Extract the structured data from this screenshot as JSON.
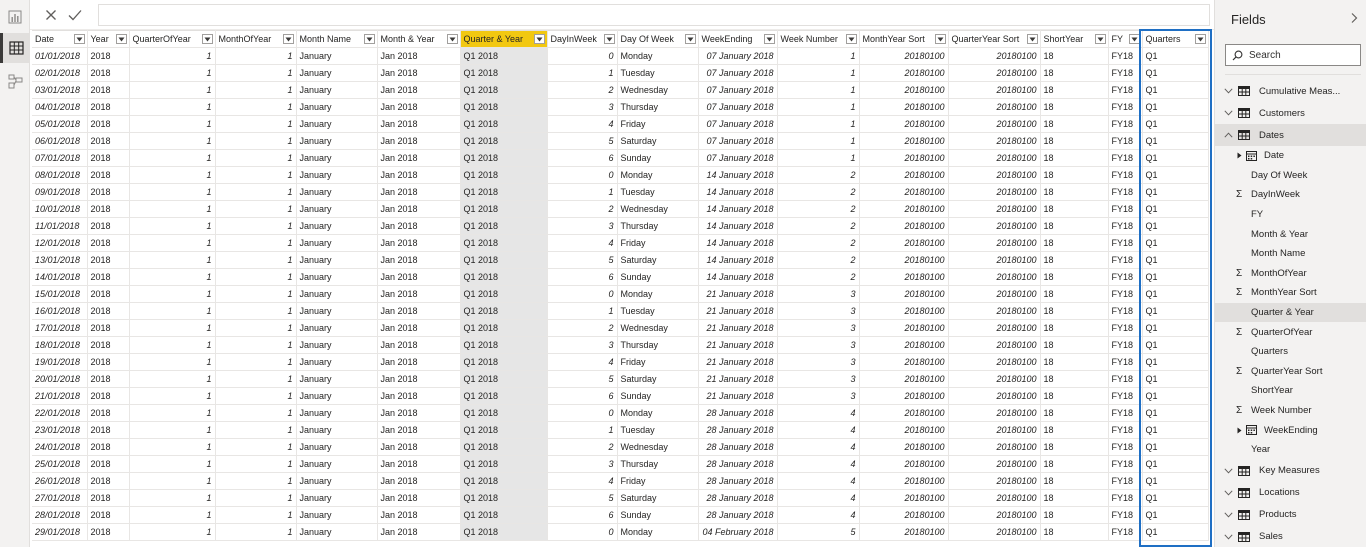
{
  "rail": {
    "icons": [
      "report-view-icon",
      "data-view-icon",
      "model-view-icon"
    ]
  },
  "formula_bar": {
    "value": ""
  },
  "grid": {
    "columns": [
      {
        "label": "Date",
        "type": "ital",
        "sort": "asc"
      },
      {
        "label": "Year",
        "type": "text"
      },
      {
        "label": "QuarterOfYear",
        "type": "num"
      },
      {
        "label": "MonthOfYear",
        "type": "num"
      },
      {
        "label": "Month Name",
        "type": "text"
      },
      {
        "label": "Month & Year",
        "type": "text"
      },
      {
        "label": "Quarter & Year",
        "type": "text",
        "selected": true
      },
      {
        "label": "DayInWeek",
        "type": "num"
      },
      {
        "label": "Day Of Week",
        "type": "text"
      },
      {
        "label": "WeekEnding",
        "type": "ital-num"
      },
      {
        "label": "Week Number",
        "type": "num"
      },
      {
        "label": "MonthYear Sort",
        "type": "num"
      },
      {
        "label": "QuarterYear Sort",
        "type": "num"
      },
      {
        "label": "ShortYear",
        "type": "text"
      },
      {
        "label": "FY",
        "type": "text"
      },
      {
        "label": "Quarters",
        "type": "text"
      }
    ],
    "rows": [
      [
        "01/01/2018",
        "2018",
        "1",
        "1",
        "January",
        "Jan 2018",
        "Q1 2018",
        "0",
        "Monday",
        "07 January 2018",
        "1",
        "20180100",
        "20180100",
        "18",
        "FY18",
        "Q1"
      ],
      [
        "02/01/2018",
        "2018",
        "1",
        "1",
        "January",
        "Jan 2018",
        "Q1 2018",
        "1",
        "Tuesday",
        "07 January 2018",
        "1",
        "20180100",
        "20180100",
        "18",
        "FY18",
        "Q1"
      ],
      [
        "03/01/2018",
        "2018",
        "1",
        "1",
        "January",
        "Jan 2018",
        "Q1 2018",
        "2",
        "Wednesday",
        "07 January 2018",
        "1",
        "20180100",
        "20180100",
        "18",
        "FY18",
        "Q1"
      ],
      [
        "04/01/2018",
        "2018",
        "1",
        "1",
        "January",
        "Jan 2018",
        "Q1 2018",
        "3",
        "Thursday",
        "07 January 2018",
        "1",
        "20180100",
        "20180100",
        "18",
        "FY18",
        "Q1"
      ],
      [
        "05/01/2018",
        "2018",
        "1",
        "1",
        "January",
        "Jan 2018",
        "Q1 2018",
        "4",
        "Friday",
        "07 January 2018",
        "1",
        "20180100",
        "20180100",
        "18",
        "FY18",
        "Q1"
      ],
      [
        "06/01/2018",
        "2018",
        "1",
        "1",
        "January",
        "Jan 2018",
        "Q1 2018",
        "5",
        "Saturday",
        "07 January 2018",
        "1",
        "20180100",
        "20180100",
        "18",
        "FY18",
        "Q1"
      ],
      [
        "07/01/2018",
        "2018",
        "1",
        "1",
        "January",
        "Jan 2018",
        "Q1 2018",
        "6",
        "Sunday",
        "07 January 2018",
        "1",
        "20180100",
        "20180100",
        "18",
        "FY18",
        "Q1"
      ],
      [
        "08/01/2018",
        "2018",
        "1",
        "1",
        "January",
        "Jan 2018",
        "Q1 2018",
        "0",
        "Monday",
        "14 January 2018",
        "2",
        "20180100",
        "20180100",
        "18",
        "FY18",
        "Q1"
      ],
      [
        "09/01/2018",
        "2018",
        "1",
        "1",
        "January",
        "Jan 2018",
        "Q1 2018",
        "1",
        "Tuesday",
        "14 January 2018",
        "2",
        "20180100",
        "20180100",
        "18",
        "FY18",
        "Q1"
      ],
      [
        "10/01/2018",
        "2018",
        "1",
        "1",
        "January",
        "Jan 2018",
        "Q1 2018",
        "2",
        "Wednesday",
        "14 January 2018",
        "2",
        "20180100",
        "20180100",
        "18",
        "FY18",
        "Q1"
      ],
      [
        "11/01/2018",
        "2018",
        "1",
        "1",
        "January",
        "Jan 2018",
        "Q1 2018",
        "3",
        "Thursday",
        "14 January 2018",
        "2",
        "20180100",
        "20180100",
        "18",
        "FY18",
        "Q1"
      ],
      [
        "12/01/2018",
        "2018",
        "1",
        "1",
        "January",
        "Jan 2018",
        "Q1 2018",
        "4",
        "Friday",
        "14 January 2018",
        "2",
        "20180100",
        "20180100",
        "18",
        "FY18",
        "Q1"
      ],
      [
        "13/01/2018",
        "2018",
        "1",
        "1",
        "January",
        "Jan 2018",
        "Q1 2018",
        "5",
        "Saturday",
        "14 January 2018",
        "2",
        "20180100",
        "20180100",
        "18",
        "FY18",
        "Q1"
      ],
      [
        "14/01/2018",
        "2018",
        "1",
        "1",
        "January",
        "Jan 2018",
        "Q1 2018",
        "6",
        "Sunday",
        "14 January 2018",
        "2",
        "20180100",
        "20180100",
        "18",
        "FY18",
        "Q1"
      ],
      [
        "15/01/2018",
        "2018",
        "1",
        "1",
        "January",
        "Jan 2018",
        "Q1 2018",
        "0",
        "Monday",
        "21 January 2018",
        "3",
        "20180100",
        "20180100",
        "18",
        "FY18",
        "Q1"
      ],
      [
        "16/01/2018",
        "2018",
        "1",
        "1",
        "January",
        "Jan 2018",
        "Q1 2018",
        "1",
        "Tuesday",
        "21 January 2018",
        "3",
        "20180100",
        "20180100",
        "18",
        "FY18",
        "Q1"
      ],
      [
        "17/01/2018",
        "2018",
        "1",
        "1",
        "January",
        "Jan 2018",
        "Q1 2018",
        "2",
        "Wednesday",
        "21 January 2018",
        "3",
        "20180100",
        "20180100",
        "18",
        "FY18",
        "Q1"
      ],
      [
        "18/01/2018",
        "2018",
        "1",
        "1",
        "January",
        "Jan 2018",
        "Q1 2018",
        "3",
        "Thursday",
        "21 January 2018",
        "3",
        "20180100",
        "20180100",
        "18",
        "FY18",
        "Q1"
      ],
      [
        "19/01/2018",
        "2018",
        "1",
        "1",
        "January",
        "Jan 2018",
        "Q1 2018",
        "4",
        "Friday",
        "21 January 2018",
        "3",
        "20180100",
        "20180100",
        "18",
        "FY18",
        "Q1"
      ],
      [
        "20/01/2018",
        "2018",
        "1",
        "1",
        "January",
        "Jan 2018",
        "Q1 2018",
        "5",
        "Saturday",
        "21 January 2018",
        "3",
        "20180100",
        "20180100",
        "18",
        "FY18",
        "Q1"
      ],
      [
        "21/01/2018",
        "2018",
        "1",
        "1",
        "January",
        "Jan 2018",
        "Q1 2018",
        "6",
        "Sunday",
        "21 January 2018",
        "3",
        "20180100",
        "20180100",
        "18",
        "FY18",
        "Q1"
      ],
      [
        "22/01/2018",
        "2018",
        "1",
        "1",
        "January",
        "Jan 2018",
        "Q1 2018",
        "0",
        "Monday",
        "28 January 2018",
        "4",
        "20180100",
        "20180100",
        "18",
        "FY18",
        "Q1"
      ],
      [
        "23/01/2018",
        "2018",
        "1",
        "1",
        "January",
        "Jan 2018",
        "Q1 2018",
        "1",
        "Tuesday",
        "28 January 2018",
        "4",
        "20180100",
        "20180100",
        "18",
        "FY18",
        "Q1"
      ],
      [
        "24/01/2018",
        "2018",
        "1",
        "1",
        "January",
        "Jan 2018",
        "Q1 2018",
        "2",
        "Wednesday",
        "28 January 2018",
        "4",
        "20180100",
        "20180100",
        "18",
        "FY18",
        "Q1"
      ],
      [
        "25/01/2018",
        "2018",
        "1",
        "1",
        "January",
        "Jan 2018",
        "Q1 2018",
        "3",
        "Thursday",
        "28 January 2018",
        "4",
        "20180100",
        "20180100",
        "18",
        "FY18",
        "Q1"
      ],
      [
        "26/01/2018",
        "2018",
        "1",
        "1",
        "January",
        "Jan 2018",
        "Q1 2018",
        "4",
        "Friday",
        "28 January 2018",
        "4",
        "20180100",
        "20180100",
        "18",
        "FY18",
        "Q1"
      ],
      [
        "27/01/2018",
        "2018",
        "1",
        "1",
        "January",
        "Jan 2018",
        "Q1 2018",
        "5",
        "Saturday",
        "28 January 2018",
        "4",
        "20180100",
        "20180100",
        "18",
        "FY18",
        "Q1"
      ],
      [
        "28/01/2018",
        "2018",
        "1",
        "1",
        "January",
        "Jan 2018",
        "Q1 2018",
        "6",
        "Sunday",
        "28 January 2018",
        "4",
        "20180100",
        "20180100",
        "18",
        "FY18",
        "Q1"
      ],
      [
        "29/01/2018",
        "2018",
        "1",
        "1",
        "January",
        "Jan 2018",
        "Q1 2018",
        "0",
        "Monday",
        "04 February 2018",
        "5",
        "20180100",
        "20180100",
        "18",
        "FY18",
        "Q1"
      ]
    ]
  },
  "fields_pane": {
    "title": "Fields",
    "search_placeholder": "Search",
    "items": [
      {
        "kind": "table",
        "label": "Cumulative Meas...",
        "expanded": false
      },
      {
        "kind": "table",
        "label": "Customers",
        "expanded": false
      },
      {
        "kind": "table",
        "label": "Dates",
        "expanded": true,
        "active": true
      },
      {
        "kind": "hierarchy",
        "label": "Date"
      },
      {
        "kind": "field",
        "label": "Day Of Week"
      },
      {
        "kind": "sum",
        "label": "DayInWeek"
      },
      {
        "kind": "field",
        "label": "FY"
      },
      {
        "kind": "field",
        "label": "Month & Year"
      },
      {
        "kind": "field",
        "label": "Month Name"
      },
      {
        "kind": "sum",
        "label": "MonthOfYear"
      },
      {
        "kind": "sum",
        "label": "MonthYear Sort"
      },
      {
        "kind": "field",
        "label": "Quarter & Year",
        "active": true
      },
      {
        "kind": "sum",
        "label": "QuarterOfYear"
      },
      {
        "kind": "field",
        "label": "Quarters"
      },
      {
        "kind": "sum",
        "label": "QuarterYear Sort"
      },
      {
        "kind": "field",
        "label": "ShortYear"
      },
      {
        "kind": "sum",
        "label": "Week Number"
      },
      {
        "kind": "hierarchy",
        "label": "WeekEnding"
      },
      {
        "kind": "field",
        "label": "Year"
      },
      {
        "kind": "table",
        "label": "Key Measures",
        "expanded": false
      },
      {
        "kind": "table",
        "label": "Locations",
        "expanded": false
      },
      {
        "kind": "table",
        "label": "Products",
        "expanded": false
      },
      {
        "kind": "table",
        "label": "Sales",
        "expanded": false
      }
    ]
  },
  "colors": {
    "selected_header": "#f2c811",
    "selected_column": "#e6e6e6",
    "highlight_box": "#1f6fc4"
  }
}
